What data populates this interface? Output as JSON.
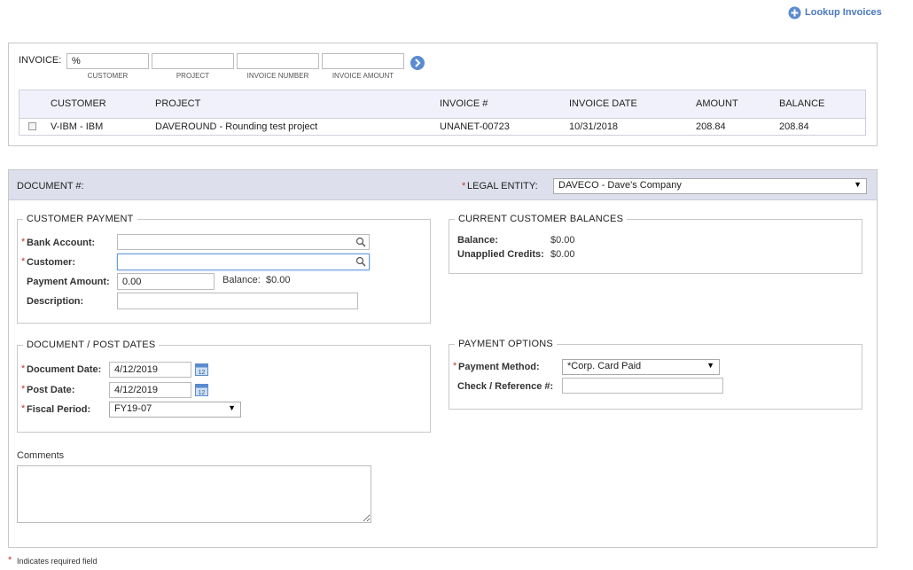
{
  "header": {
    "lookup_label": "Lookup Invoices"
  },
  "invoice_search": {
    "label": "INVOICE:",
    "customer_value": "%",
    "project_value": "",
    "invoice_number_value": "",
    "invoice_amount_value": "",
    "customer_caption": "CUSTOMER",
    "project_caption": "PROJECT",
    "invoice_number_caption": "INVOICE NUMBER",
    "invoice_amount_caption": "INVOICE AMOUNT"
  },
  "invoice_table": {
    "columns": [
      "CUSTOMER",
      "PROJECT",
      "INVOICE #",
      "INVOICE DATE",
      "AMOUNT",
      "BALANCE"
    ],
    "rows": [
      {
        "customer": "V-IBM - IBM",
        "project": "DAVEROUND - Rounding test project",
        "invoice_number": "UNANET-00723",
        "invoice_date": "10/31/2018",
        "amount": "208.84",
        "balance": "208.84"
      }
    ]
  },
  "document": {
    "doc_label": "DOCUMENT #:",
    "legal_entity_label": "LEGAL ENTITY:",
    "legal_entity_value": "DAVECO - Dave's Company"
  },
  "customer_payment": {
    "title": "CUSTOMER PAYMENT",
    "bank_account_label": "Bank Account:",
    "bank_account_value": "",
    "customer_label": "Customer:",
    "customer_value": "",
    "payment_amount_label": "Payment Amount:",
    "payment_amount_value": "0.00",
    "balance_label": "Balance:",
    "balance_value": "$0.00",
    "description_label": "Description:",
    "description_value": ""
  },
  "current_balances": {
    "title": "CURRENT CUSTOMER BALANCES",
    "balance_label": "Balance:",
    "balance_value": "$0.00",
    "unapplied_label": "Unapplied Credits:",
    "unapplied_value": "$0.00"
  },
  "post_dates": {
    "title": "DOCUMENT / POST DATES",
    "document_date_label": "Document Date:",
    "document_date_value": "4/12/2019",
    "post_date_label": "Post Date:",
    "post_date_value": "4/12/2019",
    "fiscal_period_label": "Fiscal Period:",
    "fiscal_period_value": "FY19-07",
    "calendar_day": "12"
  },
  "payment_options": {
    "title": "PAYMENT OPTIONS",
    "payment_method_label": "Payment Method:",
    "payment_method_value": "*Corp. Card Paid",
    "check_ref_label": "Check / Reference #:",
    "check_ref_value": ""
  },
  "comments": {
    "label": "Comments",
    "value": ""
  },
  "footer": {
    "required_mark": "*",
    "required_note": "Indicates required field"
  },
  "icons": {
    "select_arrow": "▼",
    "required_star": "*"
  },
  "colors": {
    "accent_blue": "#5b8bd0",
    "header_band": "#dde0ec",
    "table_header": "#f1f1fb",
    "required_red": "#c0392b"
  }
}
